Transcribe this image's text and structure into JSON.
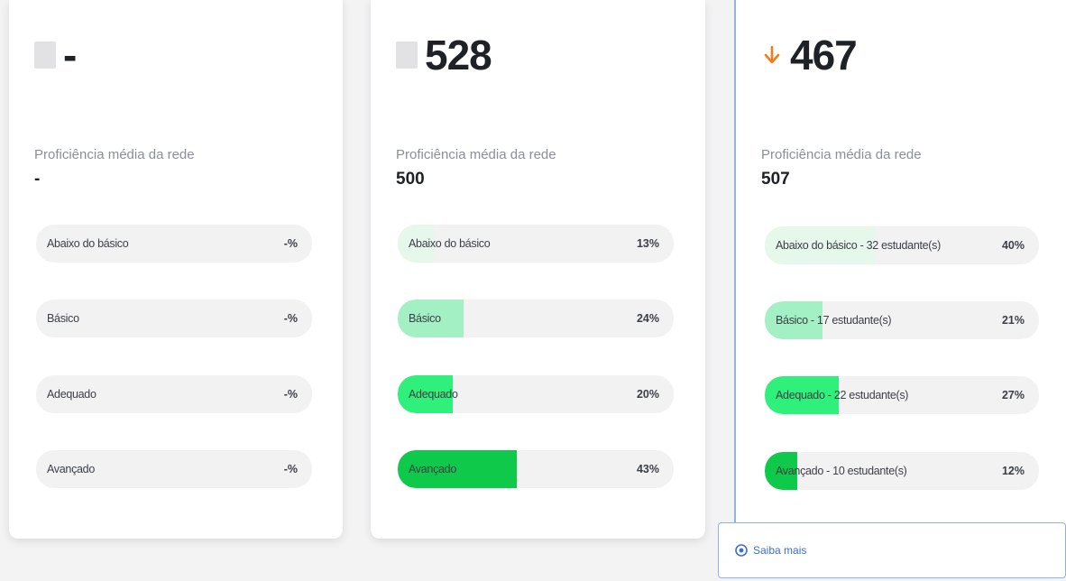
{
  "cards": [
    {
      "value": "-",
      "indicator": "placeholder",
      "proficiency_label": "Proficiência média da rede",
      "proficiency_value": "-",
      "levels": [
        {
          "name": "Abaixo do básico",
          "percent": "-%",
          "fill": 0,
          "color": "#e6f7ec"
        },
        {
          "name": "Básico",
          "percent": "-%",
          "fill": 0,
          "color": "#a3f0c4"
        },
        {
          "name": "Adequado",
          "percent": "-%",
          "fill": 0,
          "color": "#2ef07a"
        },
        {
          "name": "Avançado",
          "percent": "-%",
          "fill": 0,
          "color": "#0fc94a"
        }
      ]
    },
    {
      "value": "528",
      "indicator": "placeholder",
      "proficiency_label": "Proficiência média da rede",
      "proficiency_value": "500",
      "levels": [
        {
          "name": "Abaixo do básico",
          "percent": "13%",
          "fill": 0.13,
          "color": "#e6f7ec"
        },
        {
          "name": "Básico",
          "percent": "24%",
          "fill": 0.24,
          "color": "#a3f0c4"
        },
        {
          "name": "Adequado",
          "percent": "20%",
          "fill": 0.2,
          "color": "#2ef07a"
        },
        {
          "name": "Avançado",
          "percent": "43%",
          "fill": 0.43,
          "color": "#0fc94a"
        }
      ]
    },
    {
      "value": "467",
      "indicator": "arrow-down-icon",
      "indicator_color": "#f07d1a",
      "proficiency_label": "Proficiência média da rede",
      "proficiency_value": "507",
      "levels": [
        {
          "name": "Abaixo do básico - 32 estudante(s)",
          "percent": "40%",
          "fill": 0.4,
          "color": "#e6f7ec"
        },
        {
          "name": "Básico - 17 estudante(s)",
          "percent": "21%",
          "fill": 0.21,
          "color": "#a3f0c4"
        },
        {
          "name": "Adequado - 22 estudante(s)",
          "percent": "27%",
          "fill": 0.27,
          "color": "#2ef07a"
        },
        {
          "name": "Avançado - 10 estudante(s)",
          "percent": "12%",
          "fill": 0.12,
          "color": "#0fc94a"
        }
      ]
    }
  ],
  "saiba_mais": {
    "label": "Saiba mais",
    "icon": "eye-icon",
    "color": "#3a6fd0"
  }
}
